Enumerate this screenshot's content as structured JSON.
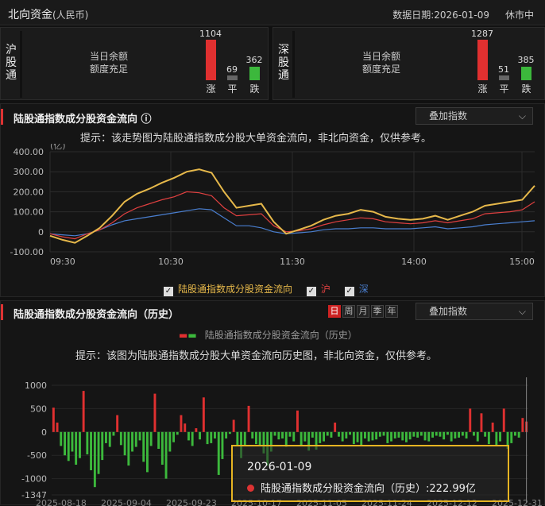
{
  "header": {
    "title": "北向资金",
    "subtitle": "(人民币)",
    "date": "数据日期:2026-01-09",
    "status": "休市中"
  },
  "sh_panel": {
    "label": "沪股通",
    "balance_label": "当日余额",
    "balance_value": "额度充足",
    "up": "1104",
    "flat": "69",
    "down": "362",
    "up_label": "涨",
    "flat_label": "平",
    "down_label": "跌"
  },
  "sz_panel": {
    "label": "深股通",
    "balance_label": "当日余额",
    "balance_value": "额度充足",
    "up": "1287",
    "flat": "51",
    "down": "385",
    "up_label": "涨",
    "flat_label": "平",
    "down_label": "跌"
  },
  "intraday": {
    "title": "陆股通指数成分股资金流向 ⓘ",
    "overlay": "叠加指数",
    "hint": "提示：该走势图为陆股通指数成分股大单资金流向，非北向资金，仅供参考。",
    "legend": [
      "陆股通指数成分股资金流向",
      "沪",
      "深"
    ]
  },
  "history": {
    "title": "陆股通指数成分股资金流向（历史）",
    "overlay": "叠加指数",
    "tabs": [
      "日",
      "周",
      "月",
      "季",
      "年"
    ],
    "legend_label": "陆股通指数成分股资金流向（历史）",
    "hint": "提示：该图为陆股通指数成分股大单资金流向历史图，非北向资金，仅供参考。",
    "x_ticks": [
      "2025-08-18",
      "2025-09-04",
      "2025-09-23",
      "2025-10-17",
      "2025-11-05",
      "2025-11-24",
      "2025-12-12",
      "2025-12-31"
    ]
  },
  "tooltip": {
    "date": "2026-01-09",
    "label": "陆股通指数成分股资金流向（历史）",
    "value": ":222.99亿"
  },
  "colors": {
    "total": "#e6b84a",
    "sh": "#e04040",
    "sz": "#4a7fd0",
    "up": "#e03030",
    "down": "#3cb83c",
    "flat": "#666666"
  },
  "chart_data": [
    {
      "type": "line",
      "unit": "(亿)",
      "x_ticks": [
        "09:30",
        "10:30",
        "11:30",
        "14:00",
        "15:00"
      ],
      "ylim": [
        -100,
        400
      ],
      "y_ticks": [
        "400.00",
        "300.00",
        "200.00",
        "100.00",
        "0",
        "-100.00"
      ],
      "grid": true,
      "series": [
        {
          "name": "陆股通指数成分股资金流向",
          "values": [
            -20,
            -40,
            -55,
            -20,
            20,
            80,
            150,
            190,
            215,
            245,
            270,
            300,
            312,
            295,
            200,
            120,
            130,
            140,
            50,
            -10,
            10,
            30,
            60,
            80,
            90,
            110,
            100,
            75,
            65,
            60,
            65,
            80,
            60,
            80,
            100,
            130,
            140,
            150,
            160,
            230
          ]
        },
        {
          "name": "沪",
          "values": [
            -10,
            -25,
            -35,
            -10,
            10,
            45,
            90,
            120,
            140,
            160,
            175,
            200,
            195,
            180,
            120,
            80,
            85,
            90,
            30,
            0,
            5,
            15,
            35,
            50,
            60,
            70,
            65,
            50,
            45,
            40,
            45,
            55,
            45,
            55,
            65,
            90,
            95,
            100,
            110,
            150
          ]
        },
        {
          "name": "深",
          "values": [
            -10,
            -15,
            -20,
            -10,
            10,
            35,
            55,
            65,
            75,
            85,
            95,
            105,
            115,
            110,
            70,
            30,
            30,
            20,
            0,
            -10,
            -5,
            0,
            10,
            15,
            15,
            20,
            20,
            15,
            15,
            15,
            20,
            25,
            15,
            20,
            25,
            35,
            40,
            45,
            50,
            55
          ]
        }
      ]
    },
    {
      "type": "bar",
      "name": "陆股通指数成分股资金流向（历史）",
      "ylim": [
        -1347,
        1000
      ],
      "y_ticks": [
        "1000",
        "500",
        "0",
        "-500",
        "-1000",
        "-1347"
      ],
      "values": [
        520,
        200,
        -300,
        -500,
        -620,
        -420,
        -700,
        -560,
        880,
        -480,
        -820,
        -1180,
        -900,
        -600,
        -240,
        -320,
        -80,
        360,
        -280,
        -500,
        -720,
        -420,
        -320,
        -180,
        -640,
        -860,
        -300,
        820,
        -360,
        -700,
        -1000,
        -420,
        -220,
        -60,
        360,
        180,
        -180,
        -300,
        80,
        -160,
        740,
        -260,
        -240,
        -140,
        -920,
        -580,
        -140,
        -40,
        260,
        -280,
        -560,
        -300,
        560,
        -140,
        -260,
        -280,
        -460,
        -720,
        -420,
        -80,
        -160,
        -140,
        -320,
        -100,
        -200,
        460,
        -300,
        -200,
        -400,
        -120,
        -380,
        -240,
        -200,
        -80,
        -120,
        200,
        -100,
        -200,
        -140,
        -60,
        -260,
        -220,
        -300,
        -140,
        -200,
        -180,
        -160,
        -100,
        -80,
        -240,
        -200,
        -140,
        -120,
        -180,
        -220,
        -160,
        -100,
        -120,
        -80,
        -180,
        -200,
        -120,
        -80,
        -100,
        -160,
        -60,
        -200,
        -140,
        -120,
        -80,
        -140,
        500,
        -80,
        -200,
        400,
        -100,
        -260,
        200,
        -300,
        -200,
        500,
        -360,
        -240,
        -80,
        -120,
        300,
        223
      ]
    }
  ]
}
